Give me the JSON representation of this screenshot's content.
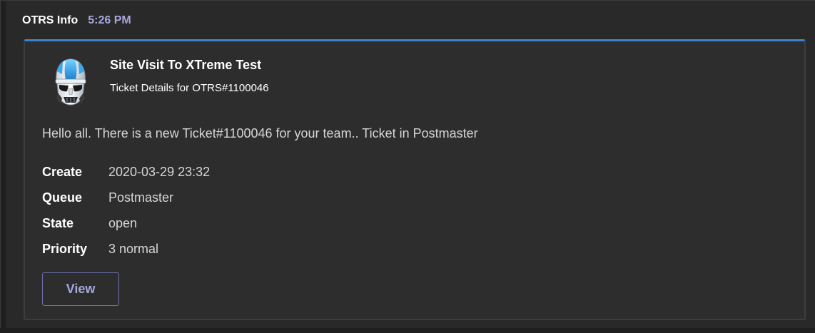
{
  "message": {
    "sender": "OTRS Info",
    "timestamp": "5:26 PM"
  },
  "card": {
    "avatar_icon": "stormtrooper-helmet-icon",
    "title": "Site Visit To XTreme Test",
    "subtitle": "Ticket Details for OTRS#1100046",
    "body": "Hello all. There is a new Ticket#1100046 for your team.. Ticket in Postmaster",
    "facts": [
      {
        "key": "Create",
        "value": "2020-03-29 23:32"
      },
      {
        "key": "Queue",
        "value": "Postmaster"
      },
      {
        "key": "State",
        "value": "open"
      },
      {
        "key": "Priority",
        "value": "3 normal"
      }
    ],
    "view_label": "View"
  },
  "colors": {
    "accent": "#3b83c9",
    "timestamp": "#a6a7dc",
    "button_border": "#6f70b0"
  }
}
